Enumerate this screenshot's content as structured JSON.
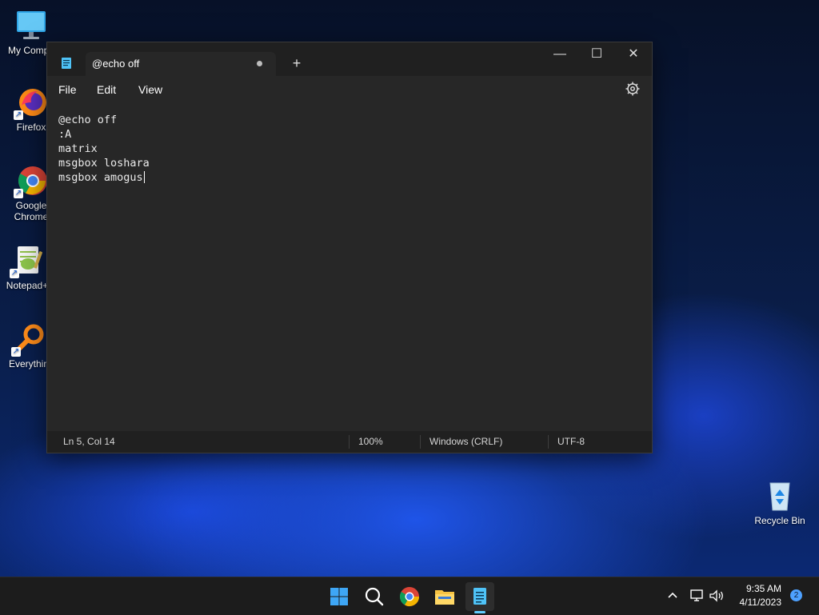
{
  "desktop": {
    "icons": [
      {
        "label": "My Compu"
      },
      {
        "label": "Firefox"
      },
      {
        "label": "Google"
      },
      {
        "label": "Chrome"
      },
      {
        "label": "Notepad+"
      },
      {
        "label": "Everythin"
      },
      {
        "label": "Recycle Bin"
      }
    ]
  },
  "window": {
    "tab_title": "@echo off",
    "new_tab_symbol": "+",
    "controls": {
      "minimize": "—",
      "maximize": "☐",
      "close": "✕"
    },
    "menu": [
      "File",
      "Edit",
      "View"
    ],
    "editor_lines": [
      "@echo off",
      ":A",
      "matrix",
      "msgbox loshara",
      "msgbox amogus"
    ],
    "status": {
      "position": "Ln 5, Col 14",
      "zoom": "100%",
      "line_ending": "Windows (CRLF)",
      "encoding": "UTF-8"
    }
  },
  "taskbar": {
    "apps": [
      "start-icon",
      "search-icon",
      "chrome-icon",
      "file-explorer-icon",
      "notepad-icon"
    ],
    "clock_time": "9:35 AM",
    "clock_date": "4/11/2023",
    "notification_count": "2"
  }
}
